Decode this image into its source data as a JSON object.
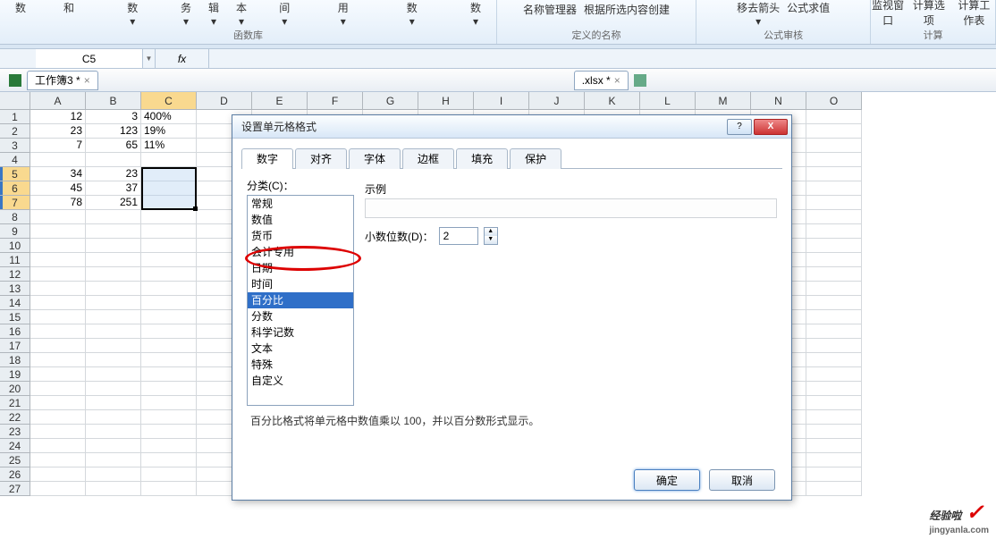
{
  "ribbon": {
    "g1a": "插入函数",
    "g1b": "自动求和",
    "g1c": "最近使用的函数",
    "g1d": "财务",
    "g1e": "逻辑",
    "g1f": "文本",
    "g1g": "日期和时间",
    "g1h": "查找与引用",
    "g1i": "数学和三角函数",
    "g1j": "其他函数",
    "label1": "函数库",
    "g2a": "名称管理器",
    "g2b": "根据所选内容创建",
    "label2": "定义的名称",
    "g3a": "移去箭头",
    "g3b": "公式求值",
    "label3": "公式审核",
    "g4a": "监视窗口",
    "g4b": "计算选项",
    "g4c": "计算工作表",
    "label4": "计算"
  },
  "name_box": "C5",
  "fx": "fx",
  "doctab1": "工作簿3 *",
  "doctab2": ".xlsx *",
  "columns": [
    "A",
    "B",
    "C",
    "D",
    "E",
    "F",
    "G",
    "H",
    "I",
    "J",
    "K",
    "L",
    "M",
    "N",
    "O"
  ],
  "rows": [
    [
      "12",
      "3",
      "400%"
    ],
    [
      "23",
      "123",
      "19%"
    ],
    [
      "7",
      "65",
      "11%"
    ],
    [
      "",
      "",
      ""
    ],
    [
      "34",
      "23",
      ""
    ],
    [
      "45",
      "37",
      ""
    ],
    [
      "78",
      "251",
      ""
    ]
  ],
  "dialog": {
    "title": "设置单元格格式",
    "tabs": [
      "数字",
      "对齐",
      "字体",
      "边框",
      "填充",
      "保护"
    ],
    "cat_label": "分类(C)：",
    "categories": [
      "常规",
      "数值",
      "货币",
      "会计专用",
      "日期",
      "时间",
      "百分比",
      "分数",
      "科学记数",
      "文本",
      "特殊",
      "自定义"
    ],
    "selected_idx": 6,
    "example_label": "示例",
    "decimal_label": "小数位数(D)：",
    "decimal_value": "2",
    "description": "百分比格式将单元格中数值乘以 100，并以百分数形式显示。",
    "ok": "确定",
    "cancel": "取消"
  },
  "watermark": {
    "brand": "经验啦",
    "domain": "jingyanla.com"
  }
}
